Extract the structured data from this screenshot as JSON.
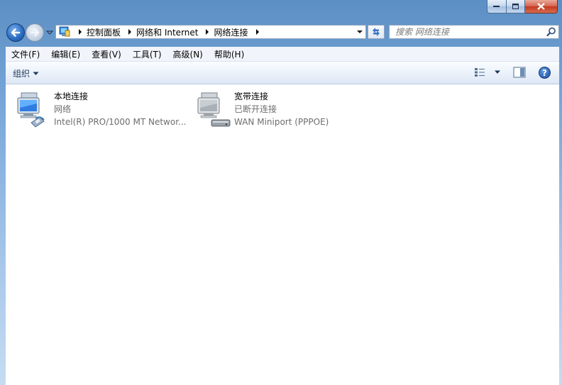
{
  "window": {
    "caption_icons": [
      "minimize-icon",
      "maximize-icon",
      "close-icon"
    ]
  },
  "address_bar": {
    "crumbs": [
      "控制面板",
      "网络和 Internet",
      "网络连接"
    ],
    "search_placeholder": "搜索 网络连接"
  },
  "menu": {
    "items": [
      "文件(F)",
      "编辑(E)",
      "查看(V)",
      "工具(T)",
      "高级(N)",
      "帮助(H)"
    ]
  },
  "command_bar": {
    "organize_label": "组织",
    "help_label": "?"
  },
  "connections": [
    {
      "name": "本地连接",
      "status": "网络",
      "device": "Intel(R) PRO/1000 MT Networ...",
      "icon": "lan-computer-icon"
    },
    {
      "name": "宽带连接",
      "status": "已断开连接",
      "device": "WAN Miniport (PPPOE)",
      "icon": "broadband-computer-icon"
    }
  ]
}
